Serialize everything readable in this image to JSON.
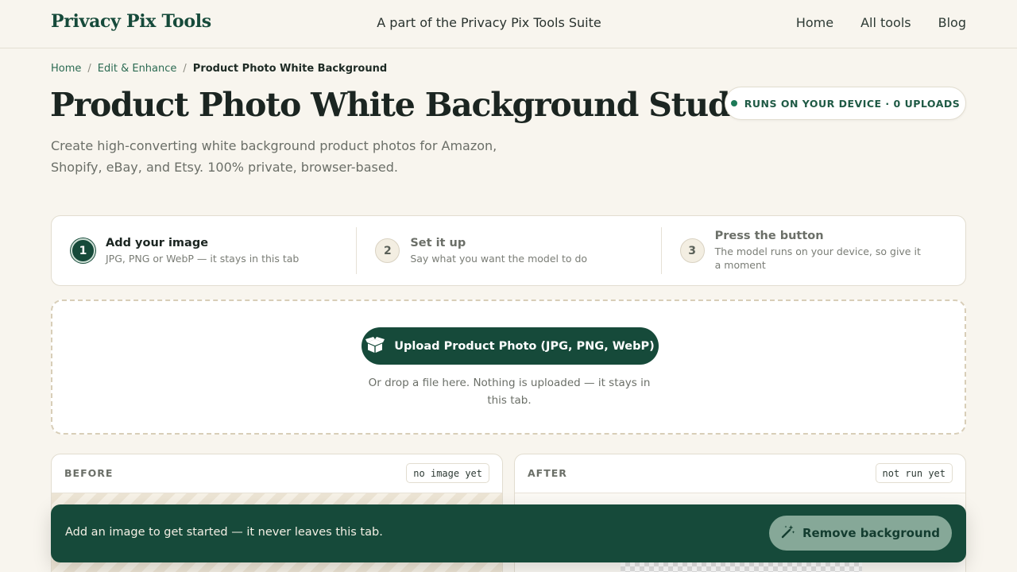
{
  "header": {
    "brand": "Privacy Pix Tools",
    "tagline": "A part of the Privacy Pix Tools Suite",
    "nav": [
      "Home",
      "All tools",
      "Blog"
    ]
  },
  "breadcrumb": {
    "items": [
      "Home",
      "Edit & Enhance"
    ],
    "current": "Product Photo White Background",
    "separator": "/"
  },
  "page": {
    "title": "Product Photo White Background Studio",
    "subtitle": "Create high-converting white background product photos for Amazon, Shopify, eBay, and Etsy. 100% private, browser-based.",
    "badge": "RUNS ON YOUR DEVICE · 0 UPLOADS"
  },
  "steps": [
    {
      "num": "1",
      "title": "Add your image",
      "desc": "JPG, PNG or WebP — it stays in this tab"
    },
    {
      "num": "2",
      "title": "Set it up",
      "desc": "Say what you want the model to do"
    },
    {
      "num": "3",
      "title": "Press the button",
      "desc": "The model runs on your device, so give it a moment"
    }
  ],
  "upload": {
    "button_label": "Upload Product Photo (JPG, PNG, WebP)",
    "note": "Or drop a file here. Nothing is uploaded — it stays in this tab."
  },
  "panels": {
    "before": {
      "label": "BEFORE",
      "status": "no image yet"
    },
    "after": {
      "label": "AFTER",
      "status": "not run yet"
    }
  },
  "actionbar": {
    "message": "Add an image to get started — it never leaves this tab.",
    "button_label": "Remove background"
  },
  "colors": {
    "brand": "#164a3a",
    "background": "#f8f5ee",
    "disabled_button": "#86a898"
  },
  "icons": {
    "upload": "open-box-icon",
    "remove": "magic-wand-icon",
    "status": "status-dot-icon"
  }
}
